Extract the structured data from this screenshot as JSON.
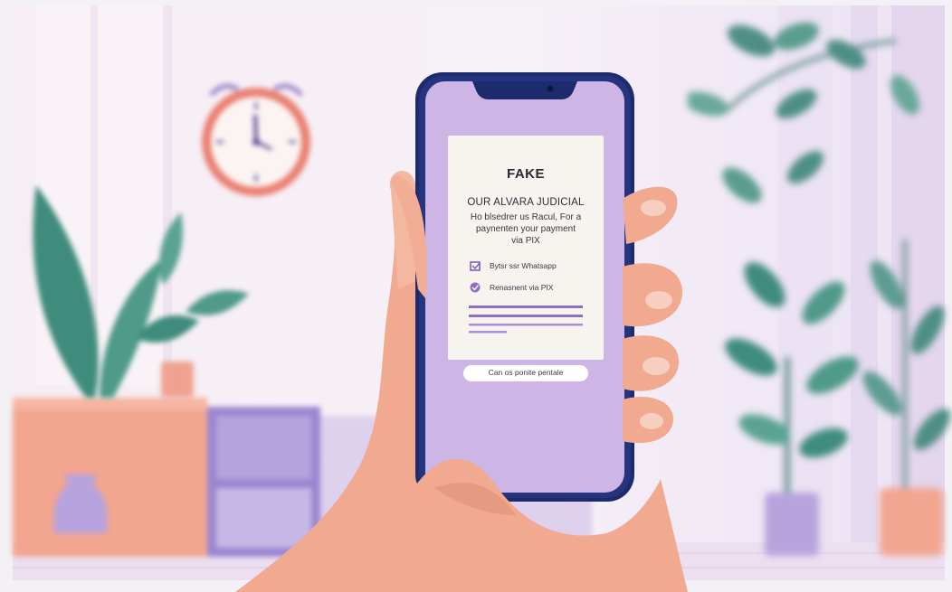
{
  "phone_screen": {
    "badge": "FAKE",
    "heading": "OUR ALVARA JUDICIAL",
    "body_line1": "Ho blsedrer us Racul, For a",
    "body_line2": "paynenten your payment",
    "body_line3": "via PIX",
    "item1": "Bytsr ssr Whatsapp",
    "item2": "Renasnent via PIX",
    "button": "Can os ponite pentale"
  },
  "icons": {
    "item1_icon": "checkbox-icon",
    "item2_icon": "check-circle-icon"
  },
  "colors": {
    "background": "#f4eef7",
    "phone_frame": "#1d2a6b",
    "phone_screen": "#cdb6e6",
    "card": "#f7f3ef",
    "accent_purple": "#8f6fc4",
    "skin": "#f1a98f",
    "plant_green": "#3f8c7c",
    "clock_ring": "#ea7f72"
  }
}
